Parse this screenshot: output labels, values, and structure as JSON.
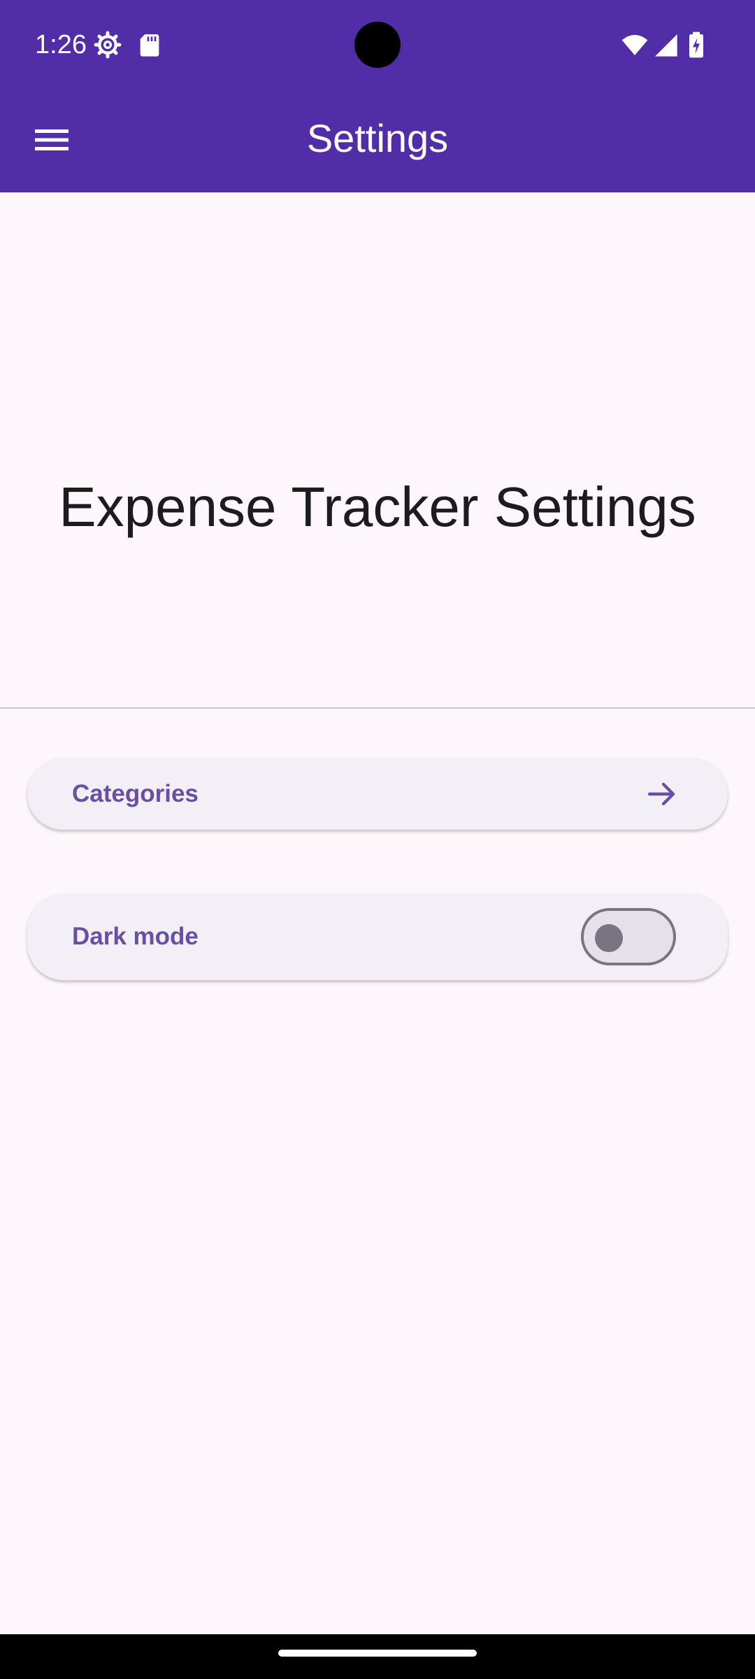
{
  "status_bar": {
    "time": "1:26",
    "icons": [
      "settings-gear-icon",
      "sd-card-icon",
      "wifi-icon",
      "signal-icon",
      "battery-charging-icon"
    ]
  },
  "app_bar": {
    "title": "Settings",
    "menu_icon": "hamburger-menu-icon",
    "background_color": "#512da8"
  },
  "main": {
    "heading": "Expense Tracker Settings",
    "items": [
      {
        "label": "Categories",
        "trailing_icon": "arrow-right-icon"
      },
      {
        "label": "Dark mode",
        "trailing_control": "switch",
        "checked": false
      }
    ]
  },
  "colors": {
    "accent": "#6750a4",
    "background": "#fdf7fb",
    "card": "#f3eff6"
  }
}
